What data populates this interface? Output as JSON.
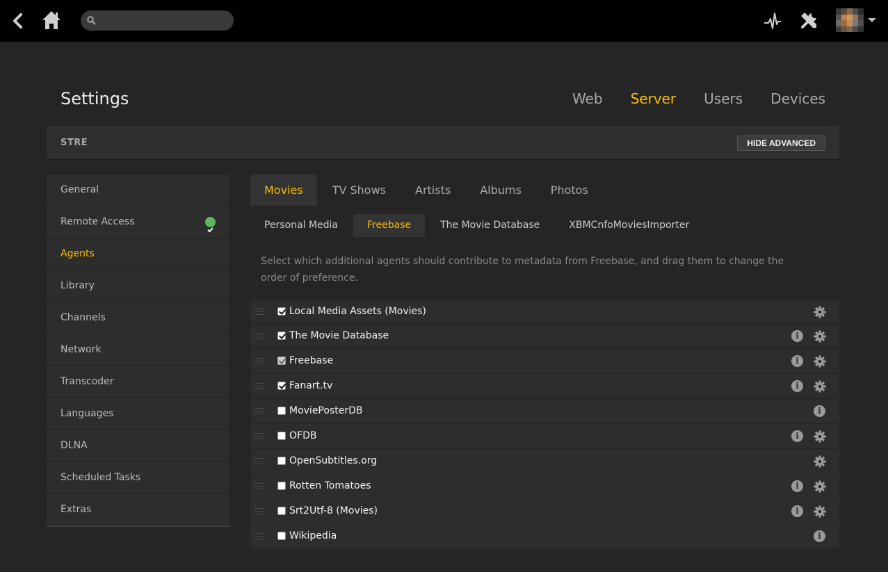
{
  "search": {
    "placeholder": ""
  },
  "header": {
    "title": "Settings",
    "tabs": [
      {
        "label": "Web"
      },
      {
        "label": "Server"
      },
      {
        "label": "Users"
      },
      {
        "label": "Devices"
      }
    ],
    "active_tab": "Server"
  },
  "server_bar": {
    "server_name": "STRE",
    "hide_advanced_label": "HIDE ADVANCED"
  },
  "sidebar": {
    "items": [
      {
        "label": "General"
      },
      {
        "label": "Remote Access",
        "status": "ok"
      },
      {
        "label": "Agents"
      },
      {
        "label": "Library"
      },
      {
        "label": "Channels"
      },
      {
        "label": "Network"
      },
      {
        "label": "Transcoder"
      },
      {
        "label": "Languages"
      },
      {
        "label": "DLNA"
      },
      {
        "label": "Scheduled Tasks"
      },
      {
        "label": "Extras"
      }
    ],
    "active_item": "Agents"
  },
  "library_tabs": [
    {
      "label": "Movies"
    },
    {
      "label": "TV Shows"
    },
    {
      "label": "Artists"
    },
    {
      "label": "Albums"
    },
    {
      "label": "Photos"
    }
  ],
  "active_library_tab": "Movies",
  "agent_tabs": [
    {
      "label": "Personal Media"
    },
    {
      "label": "Freebase"
    },
    {
      "label": "The Movie Database"
    },
    {
      "label": "XBMCnfoMoviesImporter"
    }
  ],
  "active_agent_tab": "Freebase",
  "description": "Select which additional agents should contribute to metadata from Freebase, and drag them to change the order of preference.",
  "agents": [
    {
      "name": "Local Media Assets (Movies)",
      "checked": true,
      "disabled": false,
      "info": false,
      "settings": true
    },
    {
      "name": "The Movie Database",
      "checked": true,
      "disabled": false,
      "info": true,
      "settings": true
    },
    {
      "name": "Freebase",
      "checked": true,
      "disabled": true,
      "info": true,
      "settings": true
    },
    {
      "name": "Fanart.tv",
      "checked": true,
      "disabled": false,
      "info": true,
      "settings": true
    },
    {
      "name": "MoviePosterDB",
      "checked": false,
      "disabled": false,
      "info": true,
      "settings": false
    },
    {
      "name": "OFDB",
      "checked": false,
      "disabled": false,
      "info": true,
      "settings": true
    },
    {
      "name": "OpenSubtitles.org",
      "checked": false,
      "disabled": false,
      "info": false,
      "settings": true
    },
    {
      "name": "Rotten Tomatoes",
      "checked": false,
      "disabled": false,
      "info": true,
      "settings": true
    },
    {
      "name": "Srt2Utf-8 (Movies)",
      "checked": false,
      "disabled": false,
      "info": true,
      "settings": true
    },
    {
      "name": "Wikipedia",
      "checked": false,
      "disabled": false,
      "info": true,
      "settings": false
    }
  ],
  "colors": {
    "accent": "#f9be03",
    "ok": "#5cb85c",
    "topbar": "#000000",
    "background": "#252525"
  },
  "icons": {
    "back": "back-arrow-icon",
    "home": "home-icon",
    "search": "search-icon",
    "activity": "activity-pulse-icon",
    "tools": "tools-icon",
    "info": "info-icon",
    "settings": "gear-icon",
    "status_ok": "check-circle-icon"
  }
}
